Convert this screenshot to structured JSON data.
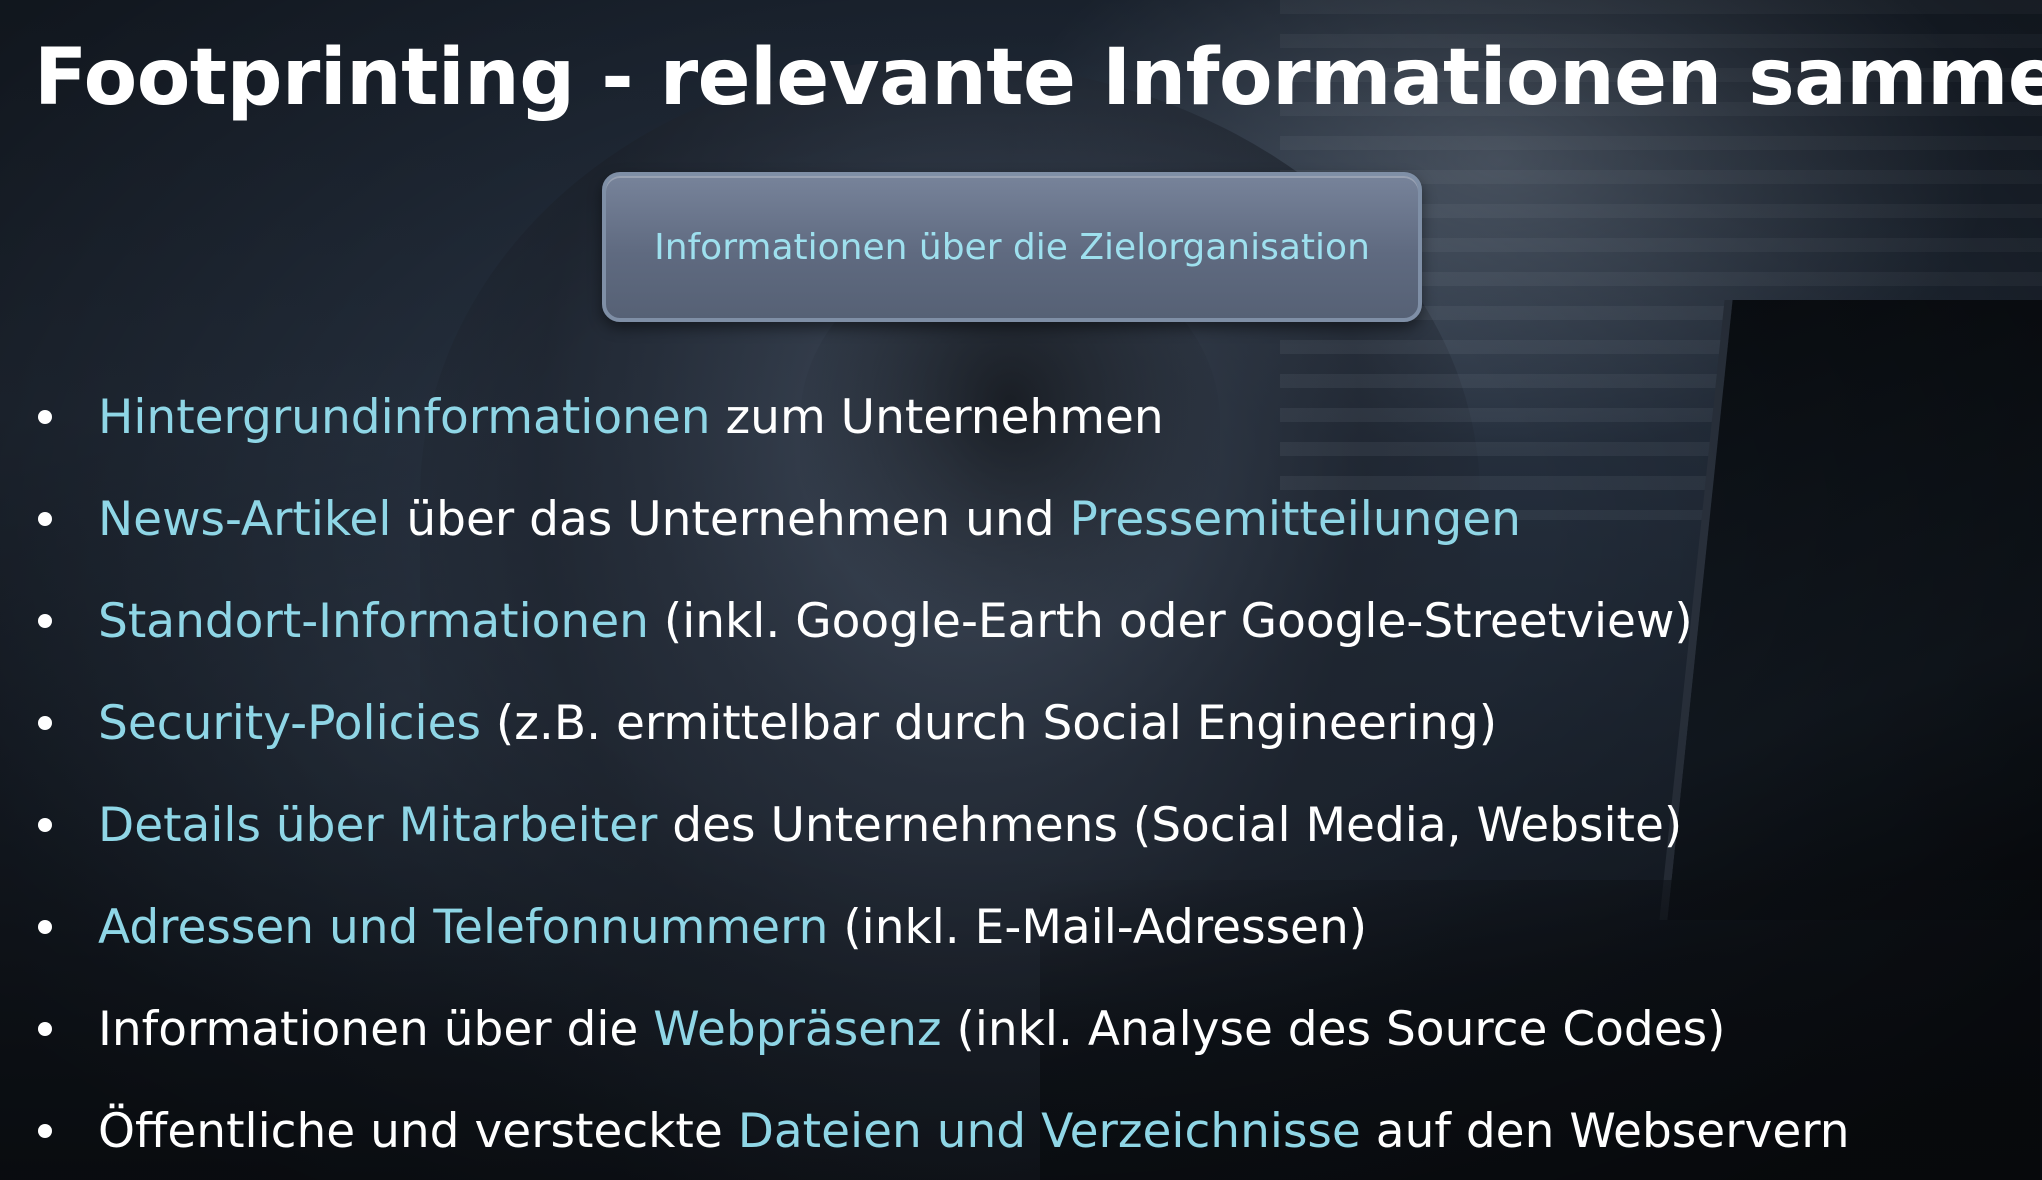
{
  "slide": {
    "title": "Footprinting - relevante Informationen sammeln",
    "box_label": "Informationen über die Zielorganisation",
    "colors": {
      "highlight": "#8fd6e6",
      "text": "#ffffff",
      "box_fill": "#657187",
      "box_text": "#9ee0ee"
    },
    "bullets": [
      {
        "parts": [
          {
            "text": "Hintergrundinformationen",
            "hl": true
          },
          {
            "text": " zum Unternehmen",
            "hl": false
          }
        ]
      },
      {
        "parts": [
          {
            "text": "News-Artikel",
            "hl": true
          },
          {
            "text": " über das Unternehmen und ",
            "hl": false
          },
          {
            "text": "Pressemitteilungen",
            "hl": true
          }
        ]
      },
      {
        "parts": [
          {
            "text": "Standort-Informationen",
            "hl": true
          },
          {
            "text": " (inkl. Google-Earth oder Google-Streetview)",
            "hl": false
          }
        ]
      },
      {
        "parts": [
          {
            "text": "Security-Policies",
            "hl": true
          },
          {
            "text": " (z.B. ermittelbar durch Social Engineering)",
            "hl": false
          }
        ]
      },
      {
        "parts": [
          {
            "text": "Details über Mitarbeiter",
            "hl": true
          },
          {
            "text": " des Unternehmens (Social Media, Website)",
            "hl": false
          }
        ]
      },
      {
        "parts": [
          {
            "text": "Adressen und Telefonnummern",
            "hl": true
          },
          {
            "text": " (inkl. E-Mail-Adressen)",
            "hl": false
          }
        ]
      },
      {
        "parts": [
          {
            "text": "Informationen über die ",
            "hl": false
          },
          {
            "text": "Webpräsenz",
            "hl": true
          },
          {
            "text": " (inkl. Analyse des Source Codes)",
            "hl": false
          }
        ]
      },
      {
        "parts": [
          {
            "text": "Öffentliche und versteckte ",
            "hl": false
          },
          {
            "text": "Dateien und Verzeichnisse",
            "hl": true
          },
          {
            "text": " auf den Webservern",
            "hl": false
          }
        ]
      }
    ]
  }
}
